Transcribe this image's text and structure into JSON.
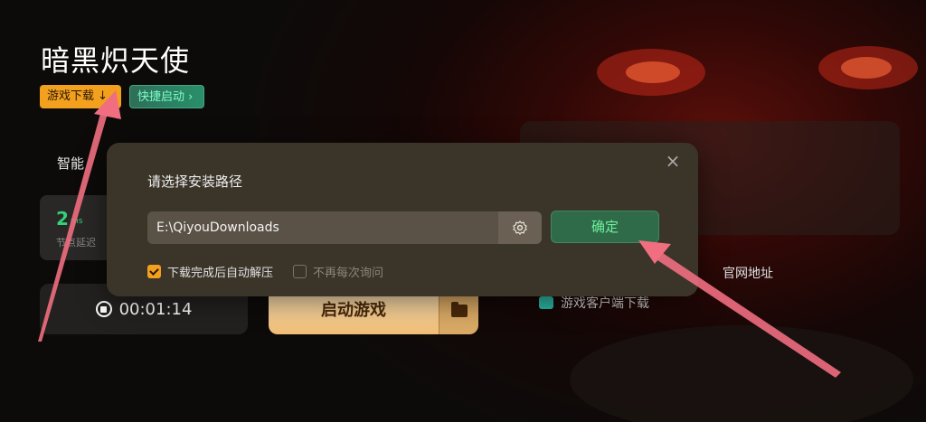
{
  "game": {
    "title": "暗黑炽天使"
  },
  "tags": {
    "download": "游戏下载 ↓",
    "quick_launch": "快捷启动 ›"
  },
  "section": {
    "smart_label": "智能"
  },
  "latency": {
    "value": "2",
    "unit": "ms",
    "label": "节点延迟"
  },
  "timer": {
    "value": "00:01:14"
  },
  "launch": {
    "label": "启动游戏"
  },
  "links": {
    "website": "官网地址",
    "client_download": "游戏客户端下载"
  },
  "modal": {
    "title": "请选择安装路径",
    "path_value": "E:\\QiyouDownloads",
    "confirm_label": "确定",
    "close_symbol": "×",
    "auto_extract_label": "下载完成后自动解压",
    "auto_extract_checked": true,
    "no_ask_label": "不再每次询问",
    "no_ask_checked": false
  },
  "colors": {
    "accent_orange": "#f2a01e",
    "confirm_green": "#2f6b48",
    "annotation_arrow": "#f06e80"
  },
  "icons": [
    "stop-icon",
    "folder-icon",
    "gear-icon",
    "close-icon",
    "check-icon",
    "client-icon"
  ]
}
